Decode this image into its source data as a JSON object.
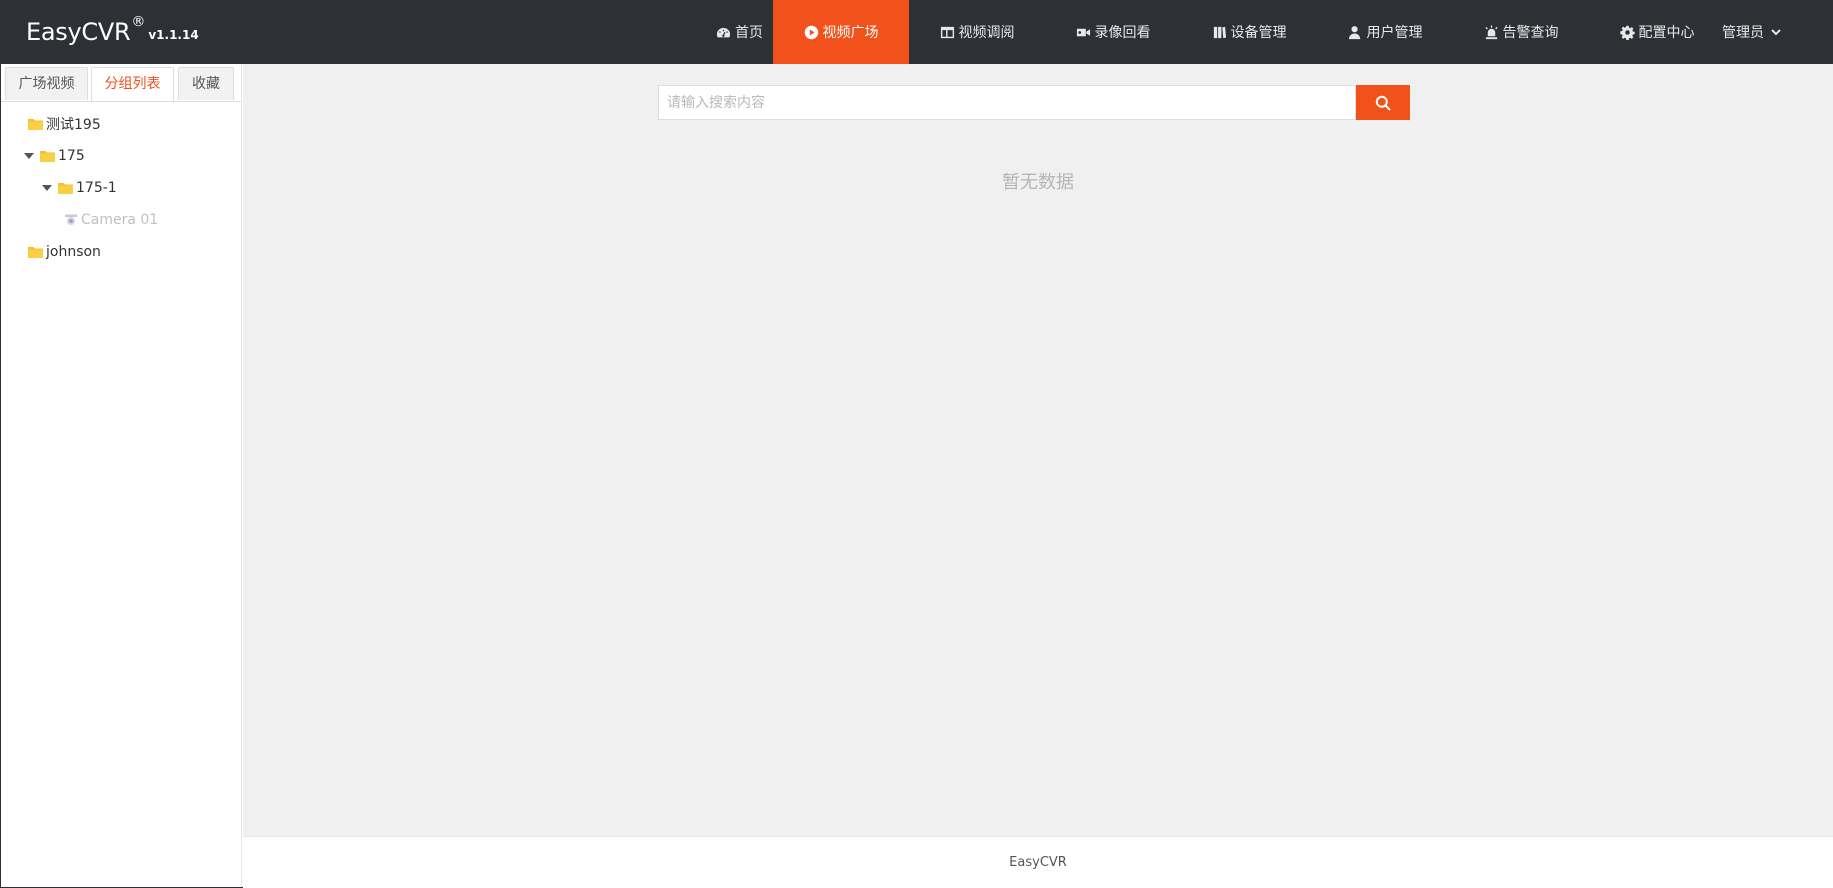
{
  "app": {
    "brand_name": "EasyCVR",
    "brand_reg": "®",
    "version": "v1.1.14"
  },
  "nav": {
    "items": [
      {
        "label": "首页",
        "icon": "dashboard-icon"
      },
      {
        "label": "视频广场",
        "icon": "play-circle-icon",
        "active": true
      },
      {
        "label": "视频调阅",
        "icon": "layout-icon"
      },
      {
        "label": "录像回看",
        "icon": "video-camera-icon"
      },
      {
        "label": "设备管理",
        "icon": "book-icon"
      },
      {
        "label": "用户管理",
        "icon": "user-icon"
      },
      {
        "label": "告警查询",
        "icon": "alarm-icon"
      },
      {
        "label": "配置中心",
        "icon": "gear-icon"
      }
    ],
    "user": "管理员",
    "accent": "#f1511b"
  },
  "sidebar": {
    "tabs": [
      {
        "label": "广场视频"
      },
      {
        "label": "分组列表",
        "active": true
      },
      {
        "label": "收藏"
      }
    ],
    "tree": [
      {
        "label": "测试195",
        "type": "folder"
      },
      {
        "label": "175",
        "type": "folder",
        "expanded": true
      },
      {
        "label": "175-1",
        "type": "folder",
        "expanded": true
      },
      {
        "label": "Camera 01",
        "type": "camera",
        "offline": true
      },
      {
        "label": "johnson",
        "type": "folder"
      }
    ]
  },
  "main": {
    "search_placeholder": "请输入搜索内容",
    "search_value": "",
    "empty_text": "暂无数据"
  },
  "footer": {
    "text": "EasyCVR"
  }
}
